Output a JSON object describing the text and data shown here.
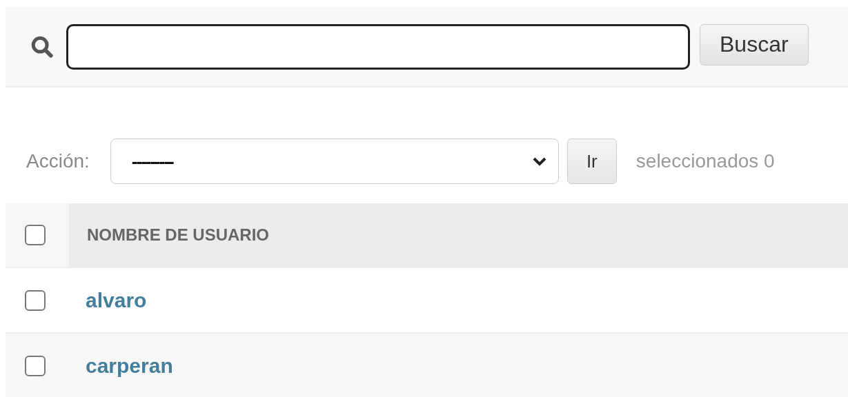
{
  "search": {
    "button": "Buscar"
  },
  "actions": {
    "label": "Acción:",
    "selected_option": "---------",
    "go_button": "Ir",
    "selection_count": "seleccionados 0"
  },
  "table": {
    "select_all_checked": false,
    "columns": [
      "NOMBRE DE USUARIO"
    ],
    "rows": [
      {
        "username": "alvaro",
        "checked": false
      },
      {
        "username": "carperan",
        "checked": false
      }
    ]
  }
}
